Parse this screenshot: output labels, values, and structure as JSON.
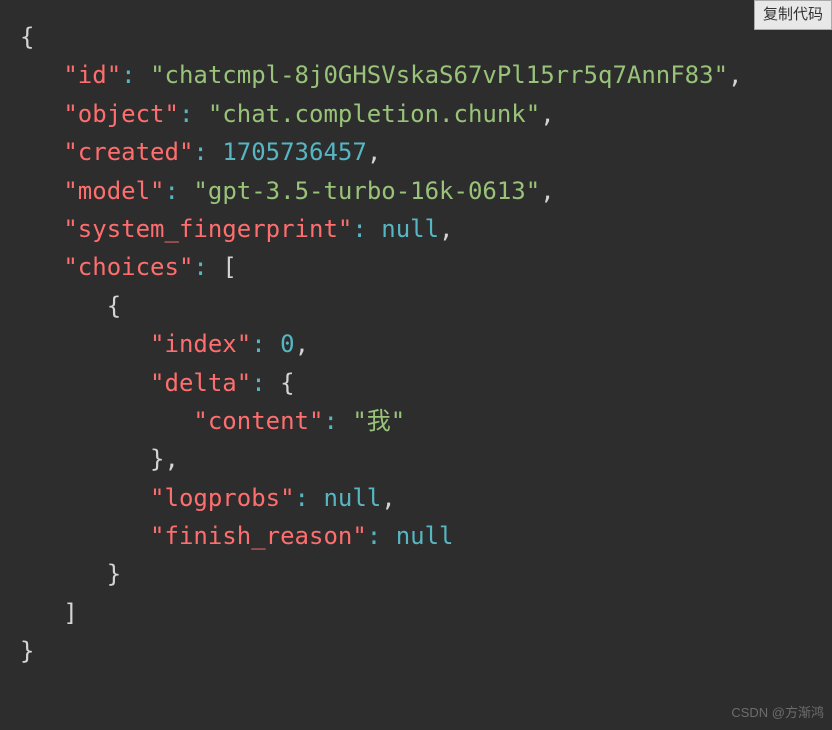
{
  "copy_button": "复制代码",
  "watermark": "CSDN @方渐鸿",
  "code": {
    "k_id": "\"id\"",
    "v_id": "\"chatcmpl-8j0GHSVskaS67vPl15rr5q7AnnF83\"",
    "k_object": "\"object\"",
    "v_object": "\"chat.completion.chunk\"",
    "k_created": "\"created\"",
    "v_created": "1705736457",
    "k_model": "\"model\"",
    "v_model": "\"gpt-3.5-turbo-16k-0613\"",
    "k_sysfp": "\"system_fingerprint\"",
    "v_sysfp": "null",
    "k_choices": "\"choices\"",
    "k_index": "\"index\"",
    "v_index": "0",
    "k_delta": "\"delta\"",
    "k_content": "\"content\"",
    "v_content": "\"我\"",
    "k_logprobs": "\"logprobs\"",
    "v_logprobs": "null",
    "k_finish": "\"finish_reason\"",
    "v_finish": "null"
  }
}
